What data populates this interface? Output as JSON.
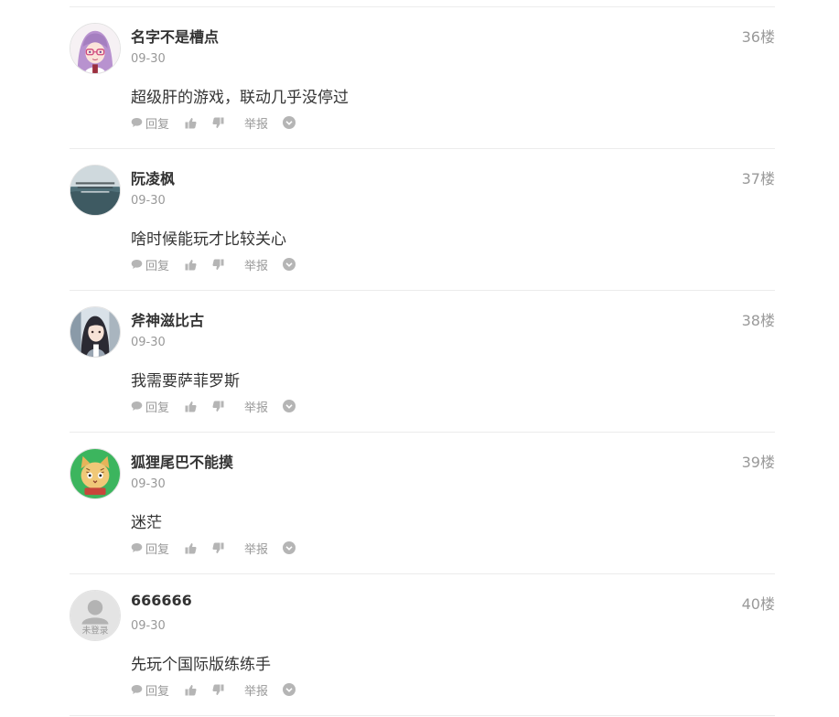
{
  "comments": [
    {
      "username": "名字不是槽点",
      "date": "09-30",
      "floor": "36楼",
      "content": "超级肝的游戏，联动几乎没停过",
      "avatar_bg": "#f6f1f4"
    },
    {
      "username": "阮凌枫",
      "date": "09-30",
      "floor": "37楼",
      "content": "啥时候能玩才比较关心",
      "avatar_bg": "#6e8c95"
    },
    {
      "username": "斧神滋比古",
      "date": "09-30",
      "floor": "38楼",
      "content": "我需要萨菲罗斯",
      "avatar_bg": "#c9d3dc"
    },
    {
      "username": "狐狸尾巴不能摸",
      "date": "09-30",
      "floor": "39楼",
      "content": "迷茫",
      "avatar_bg": "#3cb55e"
    },
    {
      "username": "666666",
      "date": "09-30",
      "floor": "40楼",
      "content": "先玩个国际版练练手",
      "avatar_bg": "#e4e4e4",
      "avatar_text": "未登录"
    }
  ],
  "actions": {
    "reply_label": "回复",
    "report_label": "举报"
  },
  "colors": {
    "icon_gray": "#b5b5b5",
    "text_gray": "#999999",
    "text_dark": "#333333",
    "divider": "#ececec"
  }
}
